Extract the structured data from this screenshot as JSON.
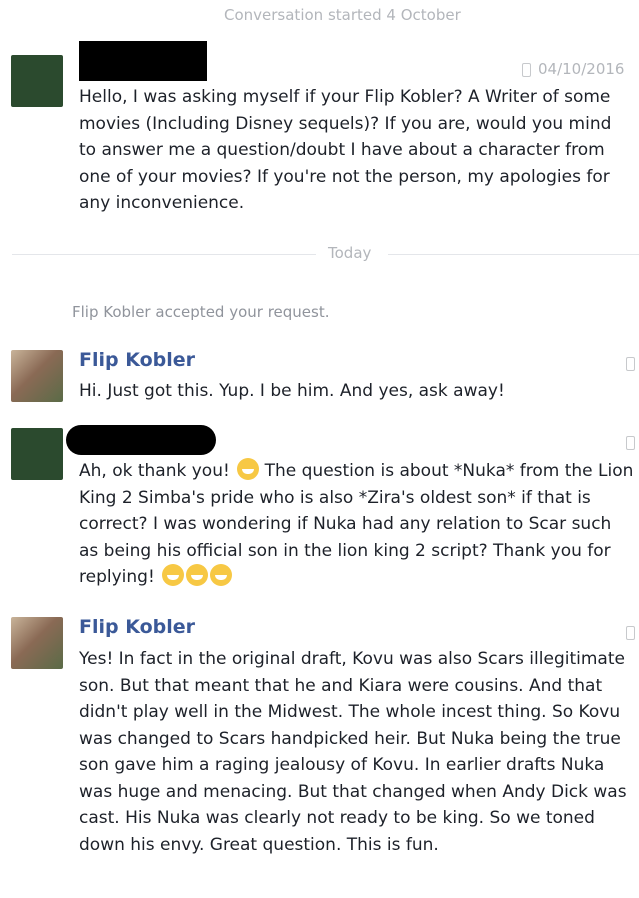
{
  "conversation_started": "Conversation started 4 October",
  "today_label": "Today",
  "system_notice": "Flip Kobler accepted your request.",
  "messages": [
    {
      "sender": "",
      "date": "04/10/2016",
      "text": "Hello, I was asking myself if your Flip Kobler? A Writer of some movies (Including Disney sequels)? If you are, would you mind to answer me a question/doubt I have about a character from one of your movies? If you're not the person, my apologies for any inconvenience."
    },
    {
      "sender": "Flip Kobler",
      "text": "Hi. Just got this. Yup. I be him. And yes, ask away!"
    },
    {
      "sender": "",
      "text_part1": "Ah, ok thank you!",
      "text_part2": "The question is about *Nuka* from the Lion King 2 Simba's pride who is also *Zira's oldest son* if that is correct? I was wondering if Nuka had any relation to Scar such as being his official son in the lion king 2 script? Thank you for replying!"
    },
    {
      "sender": "Flip Kobler",
      "text": "Yes! In fact in the original draft, Kovu was also Scars illegitimate son. But that meant that he and Kiara were cousins. And that didn't play well in the Midwest. The whole incest thing. So Kovu was changed to Scars handpicked heir. But Nuka being the true son gave him a raging jealousy of Kovu. In earlier drafts Nuka was huge and menacing. But that changed when Andy Dick was cast. His Nuka was clearly not ready to be king. So we toned down his envy. Great question. This is fun."
    }
  ],
  "icons": {
    "device": "mobile-device-icon",
    "emoji": "grinning-emoji-icon",
    "smile": "smiling-emoji-icon"
  }
}
